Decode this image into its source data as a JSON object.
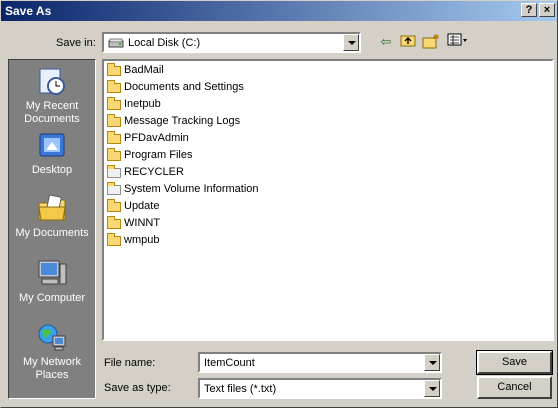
{
  "window": {
    "title": "Save As",
    "help_btn": "?",
    "close_btn": "×"
  },
  "top": {
    "save_in_label": "Save in:",
    "save_in_value": "Local Disk (C:)"
  },
  "toolbar": {
    "back_glyph": "⇦",
    "up_glyph": "⬆",
    "newfolder_glyph": "✶",
    "views_glyph": "▦"
  },
  "places": [
    {
      "label": "My Recent Documents",
      "icon": "recent-documents-icon"
    },
    {
      "label": "Desktop",
      "icon": "desktop-icon"
    },
    {
      "label": "My Documents",
      "icon": "my-documents-icon"
    },
    {
      "label": "My Computer",
      "icon": "my-computer-icon"
    },
    {
      "label": "My Network Places",
      "icon": "network-places-icon"
    }
  ],
  "files": [
    {
      "name": "BadMail"
    },
    {
      "name": "Documents and Settings"
    },
    {
      "name": "Inetpub"
    },
    {
      "name": "Message Tracking Logs"
    },
    {
      "name": "PFDavAdmin"
    },
    {
      "name": "Program Files"
    },
    {
      "name": "RECYCLER"
    },
    {
      "name": "System Volume Information"
    },
    {
      "name": "Update"
    },
    {
      "name": "WINNT"
    },
    {
      "name": "wmpub"
    }
  ],
  "bottom": {
    "filename_label": "File name:",
    "filename_value": "ItemCount",
    "savetype_label": "Save as type:",
    "savetype_value": "Text files (*.txt)",
    "save_btn": "Save",
    "cancel_btn": "Cancel"
  }
}
